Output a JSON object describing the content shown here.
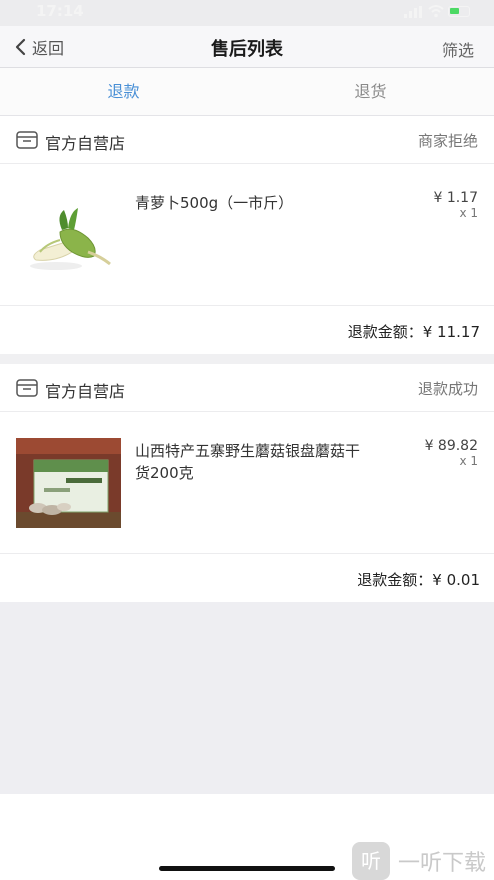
{
  "status_bar": {
    "time": "17:14"
  },
  "nav": {
    "back_label": "返回",
    "title": "售后列表",
    "filter_label": "筛选"
  },
  "tabs": [
    {
      "label": "退款",
      "active": true
    },
    {
      "label": "退货",
      "active": false
    }
  ],
  "orders": [
    {
      "shop_name": "官方自营店",
      "status": "商家拒绝",
      "item_name": "青萝卜500g（一市斤）",
      "price": "¥ 1.17",
      "quantity": "x 1",
      "refund_label": "退款金额：¥ 11.17"
    },
    {
      "shop_name": "官方自营店",
      "status": "退款成功",
      "item_name": "山西特产五寨野生蘑菇银盘蘑菇干货200克",
      "price": "¥ 89.82",
      "quantity": "x 1",
      "refund_label": "退款金额：¥ 0.01"
    }
  ],
  "watermark": {
    "logo": "听",
    "text": "一听下载"
  },
  "colors": {
    "accent": "#4a90d6",
    "background": "#f0f0f2",
    "status_green": "#4cd964"
  },
  "icons": [
    "chevron-left-icon",
    "shop-icon",
    "signal-icon",
    "wifi-icon",
    "battery-icon"
  ]
}
